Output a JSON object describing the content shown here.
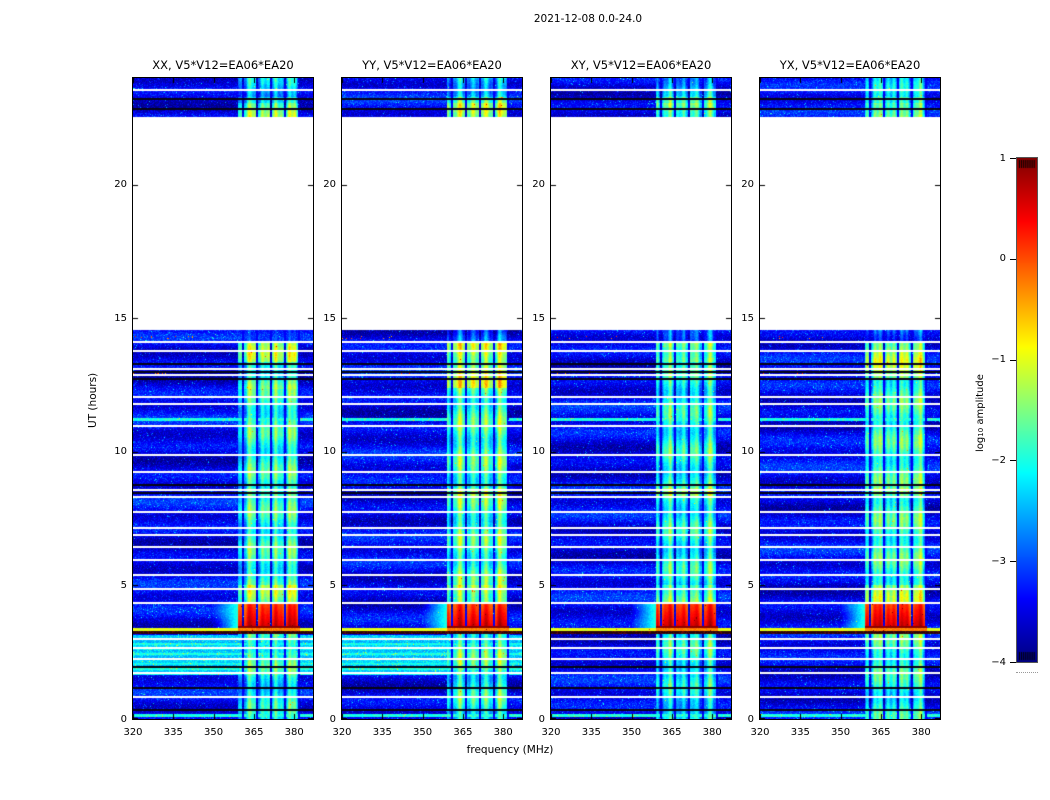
{
  "chart_data": {
    "type": "heatmap",
    "title": "2021-12-08 0.0-24.0",
    "xlabel": "frequency (MHz)",
    "ylabel": "UT (hours)",
    "colorbar": {
      "label_pre": "log",
      "label_sub": "10",
      "label_post": " amplitude",
      "ticks": [
        1,
        0,
        -1,
        -2,
        -3,
        -4
      ],
      "range": [
        -4,
        1
      ],
      "colormap": "jet"
    },
    "x_range": [
      320,
      387
    ],
    "x_ticks": [
      320,
      335,
      350,
      365,
      380
    ],
    "y_range": [
      0,
      24
    ],
    "y_ticks": [
      0,
      5,
      10,
      15,
      20
    ],
    "panels": [
      {
        "label": "XX, V5*V12=EA06*EA20",
        "seed": 11,
        "band_boost": 0.0,
        "cyan_strip": true,
        "extra_hot_rows": [
          [
            12.35,
            12.75,
            0.25
          ]
        ]
      },
      {
        "label": "YY, V5*V12=EA06*EA20",
        "seed": 22,
        "band_boost": 0.15,
        "cyan_strip": true,
        "extra_hot_rows": [
          [
            12.4,
            13.35,
            0.6
          ]
        ]
      },
      {
        "label": "XY, V5*V12=EA06*EA20",
        "seed": 33,
        "band_boost": -0.1,
        "cyan_strip": false,
        "extra_hot_rows": []
      },
      {
        "label": "YX, V5*V12=EA06*EA20",
        "seed": 44,
        "band_boost": 0.05,
        "cyan_strip": false,
        "extra_hot_rows": [
          [
            12.75,
            13.35,
            0.45
          ]
        ]
      }
    ],
    "data_blocks": [
      [
        0,
        14.55
      ],
      [
        22.55,
        24
      ]
    ],
    "band": {
      "f0": 358.9,
      "f1": 382.0,
      "separators": [
        361.0,
        366.2,
        371.4,
        376.6,
        381.8
      ],
      "base_level": -1.75
    },
    "features": {
      "white_lines": [
        23.55,
        14.11,
        13.78,
        13.1,
        12.88,
        12.06,
        11.79,
        10.97,
        9.88,
        9.25,
        8.57,
        8.31,
        7.75,
        7.15,
        6.89,
        6.44,
        5.95,
        5.39,
        4.87,
        4.34,
        3.0,
        2.66,
        2.25,
        1.72,
        0.82
      ],
      "black_lines": [
        23.2,
        22.85,
        13.28,
        12.98,
        12.72,
        8.75,
        8.45,
        1.95,
        1.15,
        0.35
      ],
      "cyan_lines": [
        11.22,
        0.12
      ],
      "hot_rows": [
        [
          13.35,
          14.1,
          0.5
        ],
        [
          8.3,
          8.65,
          0.35
        ],
        [
          4.34,
          5.0,
          0.45
        ],
        [
          22.55,
          23.05,
          0.35
        ]
      ],
      "dim_rows": [
        [
          14.1,
          14.55,
          -1.2
        ],
        [
          23.3,
          24.0,
          -0.5
        ],
        [
          0,
          1.65,
          -0.2
        ]
      ],
      "speckle_rows": [
        12.9,
        14.3
      ],
      "event": {
        "t0": 3.5,
        "t1": 4.3,
        "edge_t0": 3.42,
        "glow_f0": 349,
        "level": 0.35
      },
      "yellow_line": {
        "t0": 3.3,
        "t1": 3.42,
        "level": -1.0
      },
      "dark_line": {
        "t0": 3.18,
        "t1": 3.3
      },
      "cyan_strip": {
        "t0": 1.65,
        "t1": 3.15,
        "level": -2.45
      }
    },
    "colors": {
      "axis": "#000000",
      "background": "#ffffff",
      "noise_floor_blue": "#0000a0",
      "band_green": "#4dffb3",
      "event_red": "#d02000"
    }
  }
}
